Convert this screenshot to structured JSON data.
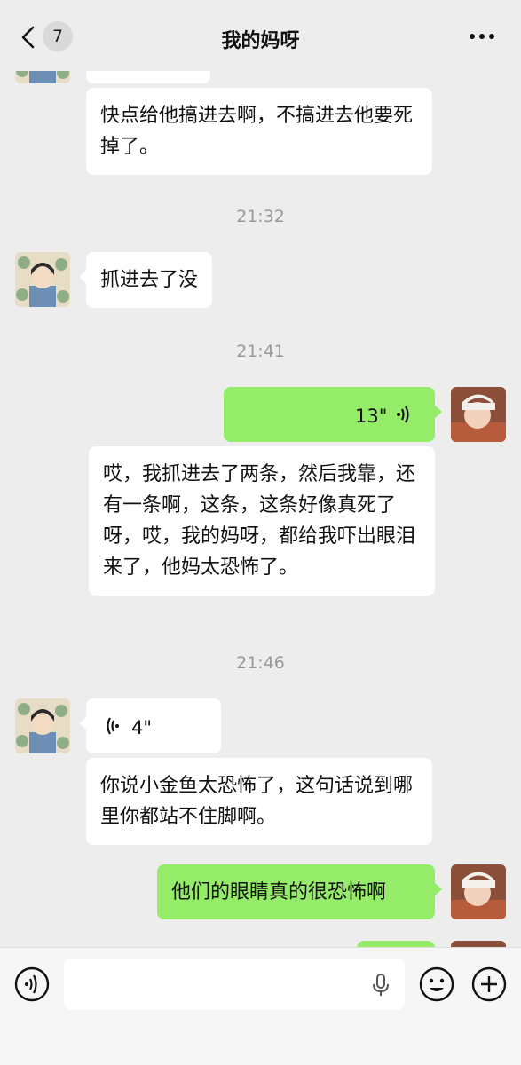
{
  "header": {
    "unread_count": "7",
    "title": "我的妈呀"
  },
  "messages": {
    "m1": "快点给他搞进去啊，不搞进去他要死掉了。",
    "ts1": "21:32",
    "m2": "抓进去了没",
    "ts2": "21:41",
    "voice_sent": "13\"",
    "m3": "哎，我抓进去了两条，然后我靠，还有一条啊，这条，这条好像真死了呀，哎，我的妈呀，都给我吓出眼泪来了，他妈太恐怖了。",
    "ts3": "21:46",
    "voice_received": "4\"",
    "m4": "你说小金鱼太恐怖了，这句话说到哪里你都站不住脚啊。",
    "m5": "他们的眼睛真的很恐怖啊"
  },
  "icons": {
    "back": "chevron-left-icon",
    "more": "more-dots-icon",
    "voice_toggle": "voice-icon",
    "mic": "mic-icon",
    "emoji": "emoji-icon",
    "add": "plus-icon"
  },
  "colors": {
    "background": "#ededed",
    "sent_bubble": "#95ec69",
    "received_bubble": "#ffffff",
    "timestamp": "#9a9a9a"
  }
}
